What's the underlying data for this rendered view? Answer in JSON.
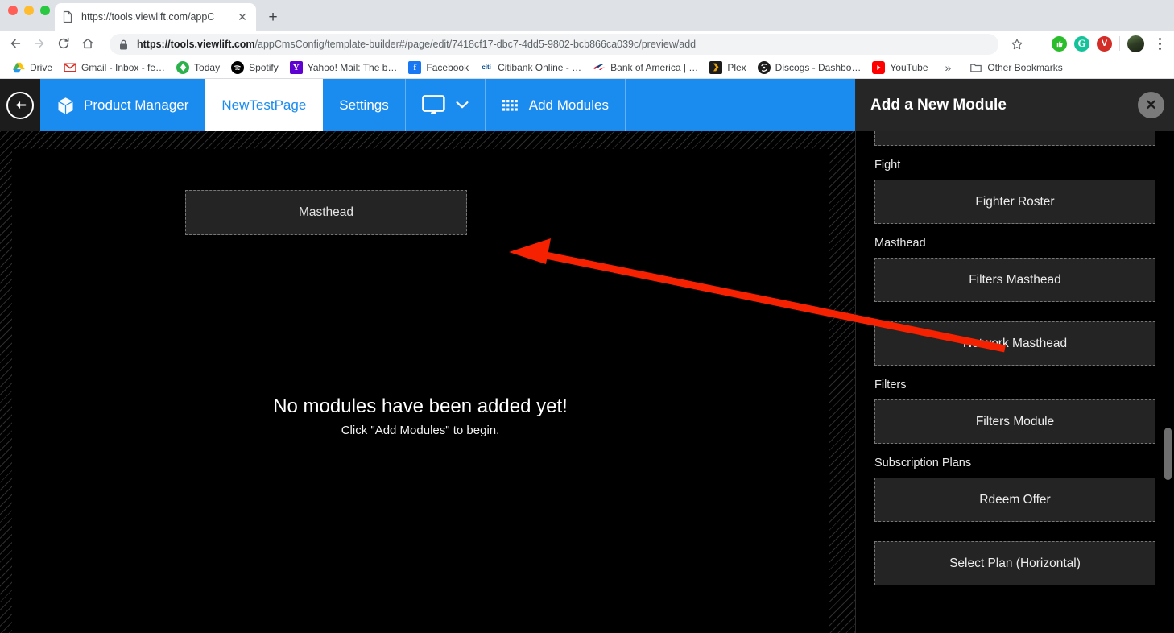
{
  "browser": {
    "tab": {
      "title": "https://tools.viewlift.com/appC",
      "favicon": "page-icon",
      "close_label": "✕"
    },
    "new_tab_label": "+",
    "nav": {
      "back": "←",
      "forward": "→",
      "reload": "⟳",
      "home": "⌂"
    },
    "omnibox": {
      "lock": "lock-icon",
      "url_domain": "https://tools.viewlift.com",
      "url_path": "/appCmsConfig/template-builder#/page/edit/7418cf17-dbc7-4dd5-9802-bcb866ca039c/preview/add",
      "star": "☆"
    },
    "extensions": [
      "thumbs-up-icon",
      "grammarly-icon",
      "lastpass-icon"
    ],
    "profile": "avatar",
    "menu": "kebab-menu-icon",
    "bookmarks": [
      {
        "label": "Drive",
        "icon": "drive-icon"
      },
      {
        "label": "Gmail - Inbox - fe…",
        "icon": "gmail-icon"
      },
      {
        "label": "Today",
        "icon": "feedly-icon"
      },
      {
        "label": "Spotify",
        "icon": "spotify-icon"
      },
      {
        "label": "Yahoo! Mail: The b…",
        "icon": "yahoo-icon"
      },
      {
        "label": "Facebook",
        "icon": "facebook-icon"
      },
      {
        "label": "Citibank Online - …",
        "icon": "citi-icon"
      },
      {
        "label": "Bank of America | …",
        "icon": "bofa-icon"
      },
      {
        "label": "Plex",
        "icon": "plex-icon"
      },
      {
        "label": "Discogs - Dashbo…",
        "icon": "discogs-icon"
      },
      {
        "label": "YouTube",
        "icon": "youtube-icon"
      }
    ],
    "bookmarks_overflow": "»",
    "other_bookmarks": {
      "label": "Other Bookmarks",
      "icon": "folder-icon"
    }
  },
  "app_bar": {
    "back": "back-arrow-icon",
    "items": [
      {
        "label": "Product Manager",
        "icon": "cube-icon",
        "active": false
      },
      {
        "label": "NewTestPage",
        "icon": "",
        "active": true
      },
      {
        "label": "Settings",
        "icon": "",
        "active": false
      }
    ],
    "device_selector": {
      "icon": "monitor-icon",
      "chevron": "chevron-down-icon"
    },
    "add_modules": {
      "label": "Add Modules",
      "icon": "grid-icon"
    }
  },
  "canvas": {
    "dragged_module": "Masthead",
    "empty_title": "No modules have been added yet!",
    "empty_subtitle": "Click \"Add Modules\" to begin."
  },
  "panel": {
    "title": "Add a New Module",
    "close": "✕",
    "groups": [
      {
        "label": "Fight",
        "modules": [
          "Fighter Roster"
        ]
      },
      {
        "label": "Masthead",
        "modules": [
          "Filters Masthead",
          "Network Masthead"
        ]
      },
      {
        "label": "Filters",
        "modules": [
          "Filters Module"
        ]
      },
      {
        "label": "Subscription Plans",
        "modules": [
          "Rdeem Offer",
          "Select Plan (Horizontal)"
        ]
      }
    ]
  },
  "colors": {
    "accent_blue": "#1a8cf0",
    "panel_header": "#262626",
    "card_bg": "#242424",
    "annotation_red": "#f52100"
  }
}
